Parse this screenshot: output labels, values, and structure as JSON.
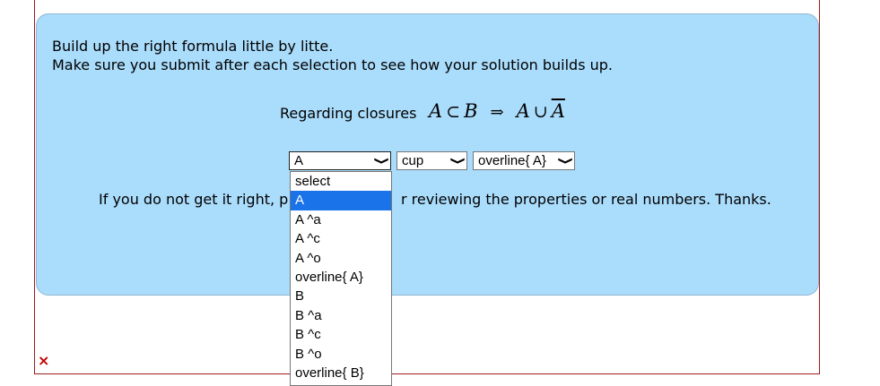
{
  "instructions": {
    "line1": "Build up the right formula little by litte.",
    "line2": "Make sure you submit after each selection to see how your solution builds up."
  },
  "regarding": {
    "label": "Regarding closures",
    "formula": {
      "a": "A",
      "sub": "⊂",
      "b": "B",
      "implies": "⇒",
      "a2": "A",
      "cup": "∪",
      "abar": "A"
    }
  },
  "selects": {
    "first": {
      "value": "A"
    },
    "second": {
      "value": "cup"
    },
    "third": {
      "value": "overline{ A}"
    }
  },
  "dropdown_options": [
    "select",
    "A",
    "A ^a",
    "A ^c",
    "A ^o",
    "overline{ A}",
    "B",
    "B ^a",
    "B ^c",
    "B ^o",
    "overline{ B}"
  ],
  "dropdown_selected_index": 1,
  "hint": {
    "part1": "If you do not get it right, p",
    "part2": "r reviewing the properties or real numbers. Thanks."
  },
  "status": {
    "mark": "×",
    "color": "#c00000"
  }
}
